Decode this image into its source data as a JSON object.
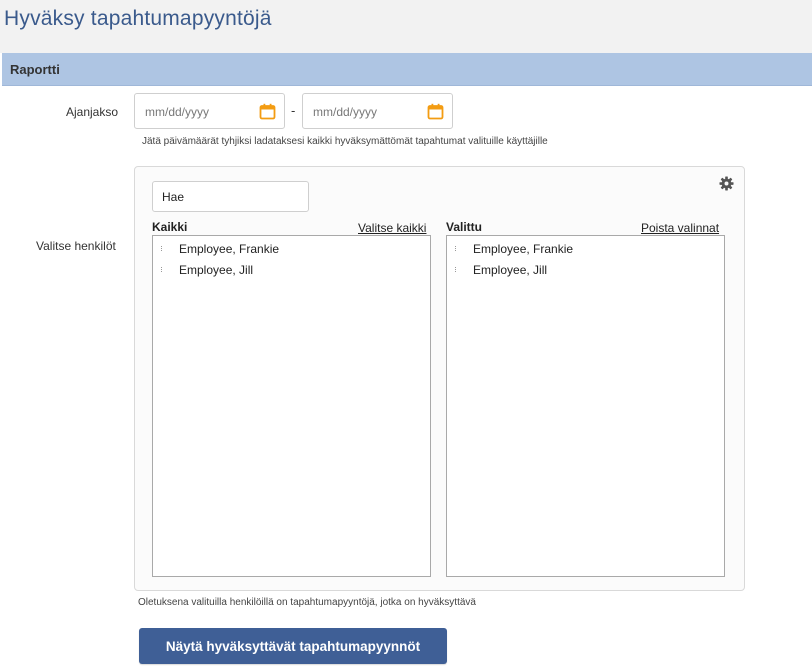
{
  "page": {
    "title": "Hyväksy tapahtumapyyntöjä"
  },
  "section": {
    "title": "Raportti"
  },
  "period": {
    "label": "Ajanjakso",
    "start_placeholder": "mm/dd/yyyy",
    "end_placeholder": "mm/dd/yyyy",
    "separator": "-",
    "hint": "Jätä päivämäärät tyhjiksi ladataksesi kaikki hyväksymättömät tapahtumat valituille käyttäjille"
  },
  "people": {
    "label": "Valitse henkilöt",
    "search_value": "Hae",
    "all_list": {
      "heading": "Kaikki",
      "action": "Valitse kaikki",
      "items": [
        "Employee, Frankie",
        "Employee, Jill"
      ]
    },
    "selected_list": {
      "heading": "Valittu",
      "action": "Poista valinnat",
      "items": [
        "Employee, Frankie",
        "Employee, Jill"
      ]
    },
    "hint": "Oletuksena valituilla henkilöillä on tapahtumapyyntöjä, jotka on hyväksyttävä"
  },
  "submit": {
    "label": "Näytä hyväksyttävät tapahtumapyynnöt"
  },
  "colors": {
    "title": "#3a5a8c",
    "section_bar": "#aec5e3",
    "calendar_icon": "#f39c12",
    "button": "#3f5f96"
  },
  "icons": {
    "calendar": "calendar-icon",
    "settings": "gear-icon",
    "bullet": "dotted-bullet-icon"
  }
}
